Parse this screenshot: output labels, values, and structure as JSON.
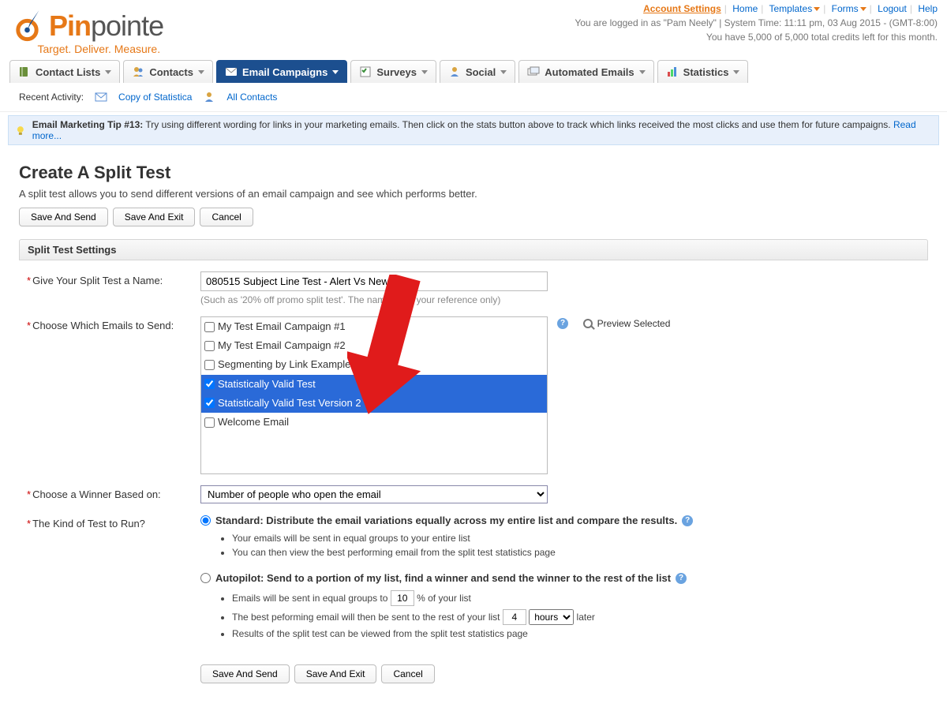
{
  "header": {
    "brand_part1": "Pin",
    "brand_part2": "pointe",
    "tagline": "Target. Deliver. Measure.",
    "account_settings": "Account Settings",
    "links": {
      "home": "Home",
      "templates": "Templates",
      "forms": "Forms",
      "logout": "Logout",
      "help": "Help"
    },
    "status1": "You are logged in as \"Pam Neely\" | System Time: 11:11 pm, 03 Aug 2015 - (GMT-8:00)",
    "status2": "You have 5,000 of 5,000 total credits left for this month."
  },
  "nav": {
    "contact_lists": "Contact Lists",
    "contacts": "Contacts",
    "email_campaigns": "Email Campaigns",
    "surveys": "Surveys",
    "social": "Social",
    "automated_emails": "Automated Emails",
    "statistics": "Statistics"
  },
  "recent": {
    "label": "Recent Activity:",
    "item1": "Copy of Statistica",
    "item2": "All Contacts"
  },
  "tip": {
    "prefix": "Email Marketing Tip #13:",
    "text": "Try using different wording for links in your marketing emails. Then click on the stats button above to track which links received the most clicks and use them for future campaigns.",
    "read_more": "Read more..."
  },
  "page": {
    "title": "Create A Split Test",
    "desc": "A split test allows you to send different versions of an email campaign and see which performs better.",
    "buttons": {
      "save_send": "Save And Send",
      "save_exit": "Save And Exit",
      "cancel": "Cancel"
    }
  },
  "panel": {
    "heading": "Split Test Settings"
  },
  "form": {
    "name_label": "Give Your Split Test a Name:",
    "name_value": "080515 Subject Line Test - Alert Vs News",
    "name_note": "(Such as '20% off promo split test'. The name is for your reference only)",
    "emails_label": "Choose Which Emails to Send:",
    "emails": [
      {
        "label": "My Test Email Campaign #1",
        "selected": false
      },
      {
        "label": "My Test Email Campaign #2",
        "selected": false
      },
      {
        "label": "Segmenting by Link Example",
        "selected": false
      },
      {
        "label": "Statistically Valid Test",
        "selected": true
      },
      {
        "label": "Statistically Valid Test Version 2",
        "selected": true
      },
      {
        "label": "Welcome Email",
        "selected": false
      }
    ],
    "preview_label": "Preview Selected",
    "winner_label": "Choose a Winner Based on:",
    "winner_value": "Number of people who open the email",
    "kind_label": "The Kind of Test to Run?",
    "standard": {
      "title": "Standard: Distribute the email variations equally across my entire list and compare the results.",
      "b1": "Your emails will be sent in equal groups to your entire list",
      "b2": "You can then view the best performing email from the split test statistics page"
    },
    "autopilot": {
      "title": "Autopilot: Send to a portion of my list, find a winner and send the winner to the rest of the list",
      "b1a": "Emails will be sent in equal groups to",
      "b1_pct": "10",
      "b1b": "% of your list",
      "b2a": "The best peforming email will then be sent to the rest of your list",
      "b2_num": "4",
      "b2_unit": "hours",
      "b2b": "later",
      "b3": "Results of the split test can be viewed from the split test statistics page"
    }
  }
}
